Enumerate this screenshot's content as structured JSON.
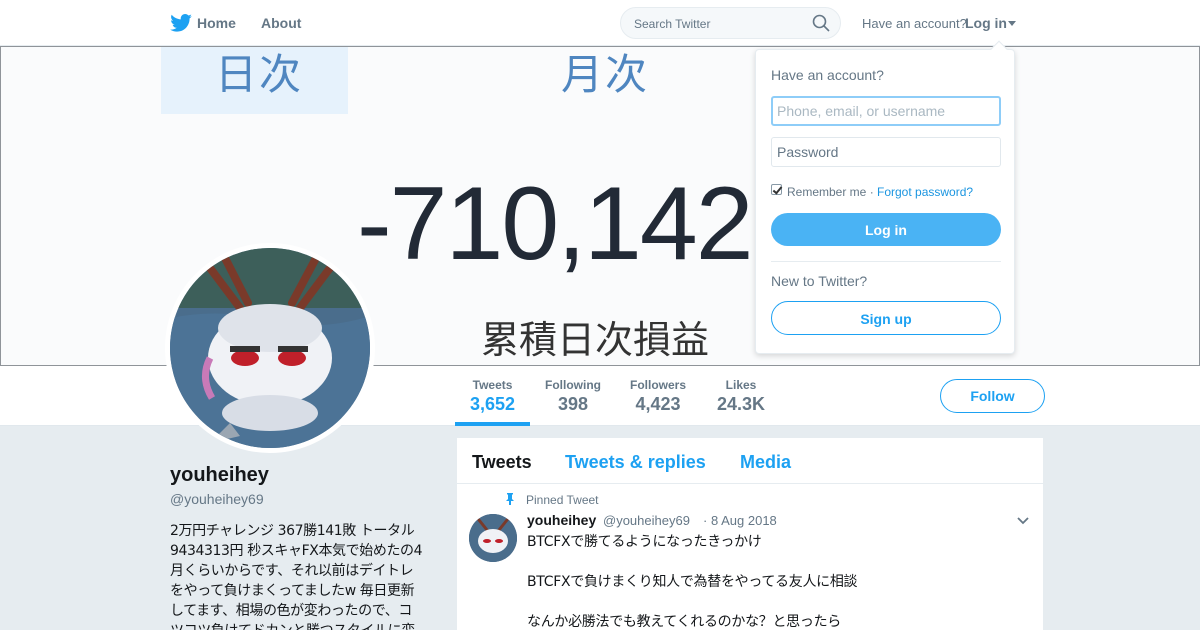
{
  "topbar": {
    "home_label": "Home",
    "about_label": "About",
    "search_placeholder": "Search Twitter",
    "have_account": "Have an account?",
    "login_label": "Log in"
  },
  "banner": {
    "tab_daily": "日次",
    "tab_monthly": "月次",
    "value": "-710,142",
    "caption": "累積日次損益"
  },
  "profile_nav": {
    "stats": [
      {
        "label": "Tweets",
        "value": "3,652"
      },
      {
        "label": "Following",
        "value": "398"
      },
      {
        "label": "Followers",
        "value": "4,423"
      },
      {
        "label": "Likes",
        "value": "24.3K"
      }
    ],
    "follow_label": "Follow"
  },
  "profile": {
    "name": "youheihey",
    "handle": "@youheihey69",
    "bio_lines": [
      "2万円チャレンジ 367勝141敗 トータル",
      "9434313円 秒スキャFX本気で始めたの4",
      "月くらいからです、それ以前はデイトレ",
      "をやって負けまくってましたw 毎日更新",
      "してます、相場の色が変わったので、コ",
      "ツコツ負けてドカンと勝つスタイルに変"
    ]
  },
  "timeline": {
    "tabs": [
      "Tweets",
      "Tweets & replies",
      "Media"
    ],
    "pinned_label": "Pinned Tweet",
    "tweet": {
      "name": "youheihey",
      "handle": "@youheihey69",
      "separator": "·",
      "date": "8 Aug 2018",
      "lines": [
        "BTCFXで勝てるようになったきっかけ",
        "BTCFXで負けまくり知人で為替をやってる友人に相談",
        "なんか必勝法でも教えてくれるのかな？と思ったら"
      ]
    }
  },
  "login_dropdown": {
    "title": "Have an account?",
    "username_placeholder": "Phone, email, or username",
    "password_placeholder": "Password",
    "remember_label": "Remember me",
    "separator": "·",
    "forgot_label": "Forgot password?",
    "login_button": "Log in",
    "new_label": "New to Twitter?",
    "signup_button": "Sign up",
    "remember_checked": true
  },
  "colors": {
    "accent": "#1da1f2",
    "login_button": "#4ab3f4",
    "page_bg": "#e6ecf0"
  }
}
